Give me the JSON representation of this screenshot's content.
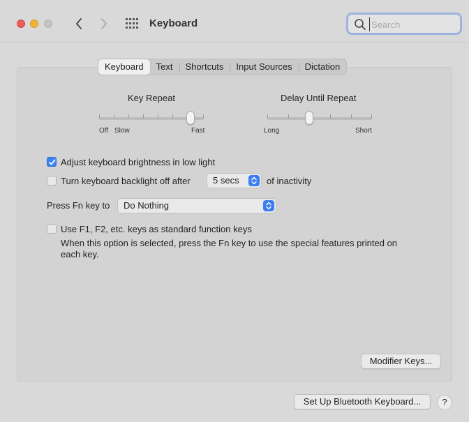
{
  "window": {
    "title": "Keyboard"
  },
  "search": {
    "placeholder": "Search",
    "value": ""
  },
  "tabs": [
    {
      "label": "Keyboard",
      "active": true
    },
    {
      "label": "Text",
      "active": false
    },
    {
      "label": "Shortcuts",
      "active": false
    },
    {
      "label": "Input Sources",
      "active": false
    },
    {
      "label": "Dictation",
      "active": false
    }
  ],
  "key_repeat": {
    "title": "Key Repeat",
    "labels": [
      "Off",
      "Slow",
      "Fast"
    ],
    "level": 0.875
  },
  "delay_until_repeat": {
    "title": "Delay Until Repeat",
    "labels": [
      "Long",
      "Short"
    ],
    "level": 0.4
  },
  "options": {
    "adjust_brightness": {
      "label": "Adjust keyboard brightness in low light",
      "checked": true
    },
    "backlight_off": {
      "label": "Turn keyboard backlight off after",
      "checked": false,
      "duration_value": "5 secs",
      "suffix": "of inactivity"
    },
    "fn_key": {
      "label": "Press Fn key to",
      "value": "Do Nothing"
    },
    "function_keys": {
      "label": "Use F1, F2, etc. keys as standard function keys",
      "checked": false,
      "description_line1": "When this option is selected, press the Fn key to use the special features printed on",
      "description_line2": "each key."
    }
  },
  "buttons": {
    "modifier_keys": "Modifier Keys...",
    "bluetooth": "Set Up Bluetooth Keyboard...",
    "help": "?"
  },
  "colors": {
    "accent": "#3b82f6",
    "close": "#ec5d55",
    "minimize": "#f1b23a"
  }
}
